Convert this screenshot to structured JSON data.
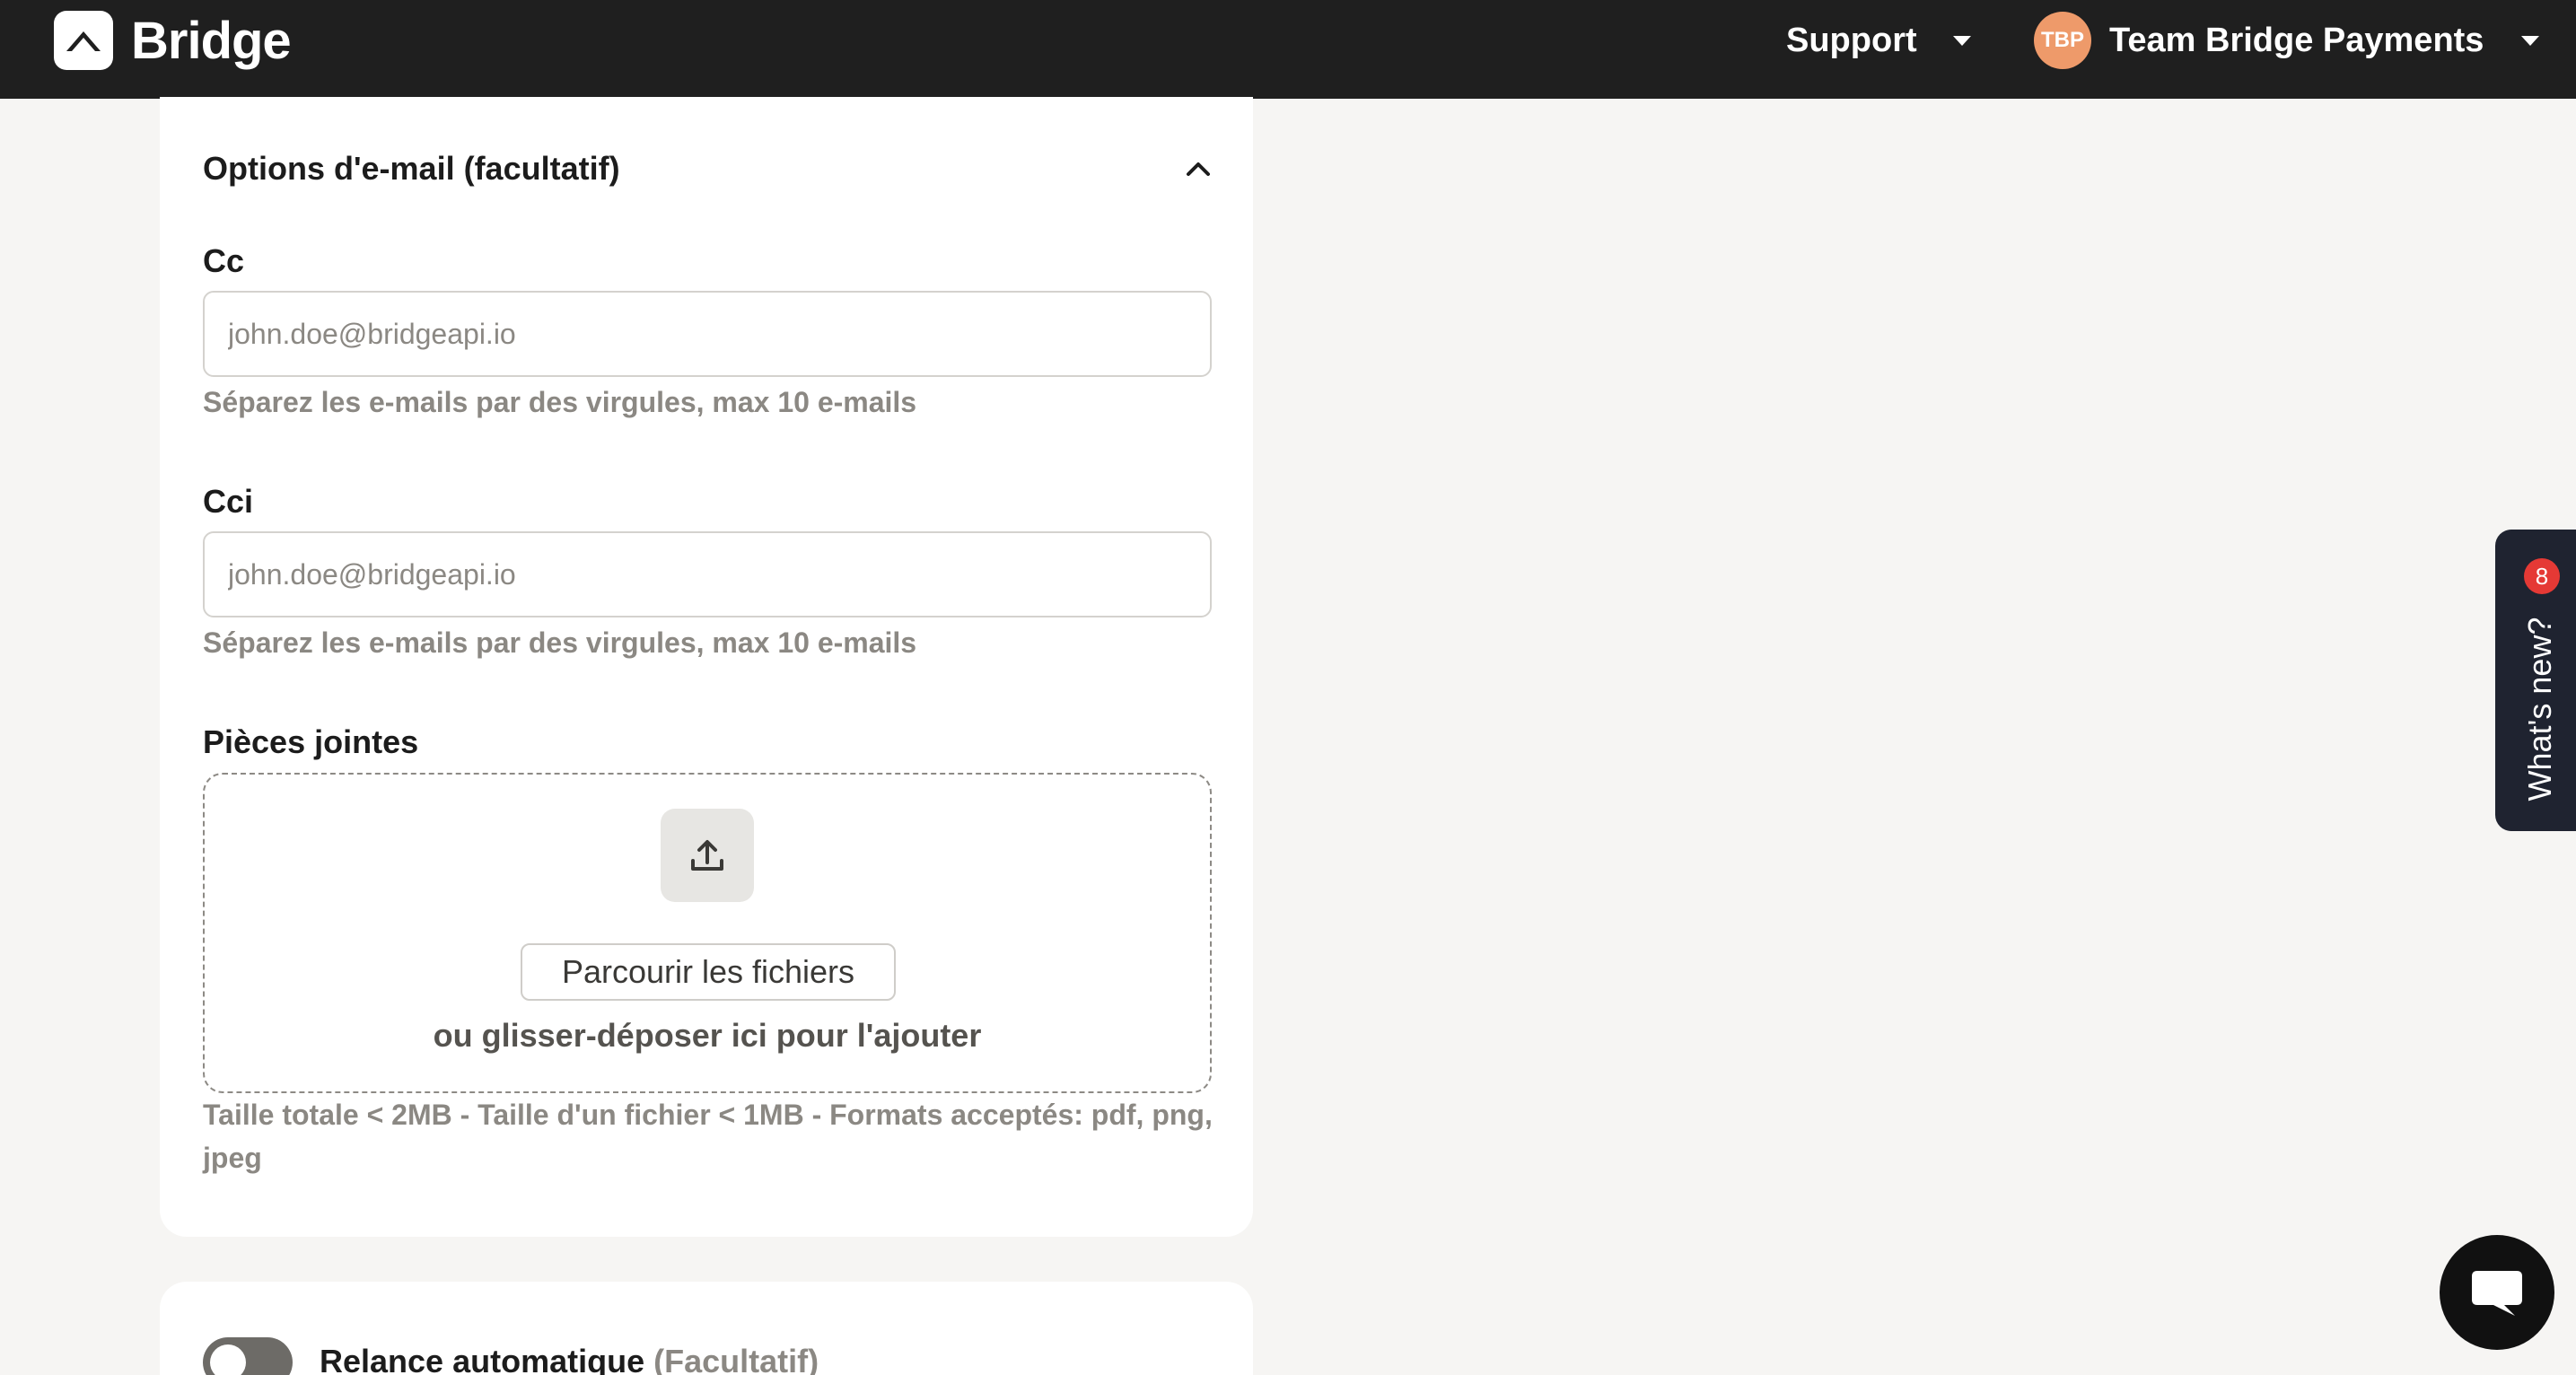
{
  "topbar": {
    "brand": "Bridge",
    "support_label": "Support",
    "team_initials": "TBP",
    "team_name": "Team Bridge Payments"
  },
  "email_options": {
    "title": "Options d'e-mail (facultatif)",
    "cc": {
      "label": "Cc",
      "placeholder": "john.doe@bridgeapi.io",
      "hint": "Séparez les e-mails par des virgules, max 10 e-mails"
    },
    "bcc": {
      "label": "Cci",
      "placeholder": "john.doe@bridgeapi.io",
      "hint": "Séparez les e-mails par des virgules, max 10 e-mails"
    },
    "attachments": {
      "label": "Pièces jointes",
      "browse_label": "Parcourir les fichiers",
      "drop_text": "ou glisser-déposer ici pour l'ajouter",
      "limits": "Taille totale < 2MB - Taille d'un fichier < 1MB - Formats acceptés: pdf, png, jpeg"
    }
  },
  "auto_reminder": {
    "label": "Relance automatique",
    "optional": "(Facultatif)",
    "enabled": false
  },
  "whats_new": {
    "label": "What's new?",
    "badge": "8"
  },
  "colors": {
    "topbar": "#1f1f1f",
    "avatar": "#ee9a6a",
    "badge": "#e53935",
    "whats_new_bg": "#1f2330"
  }
}
